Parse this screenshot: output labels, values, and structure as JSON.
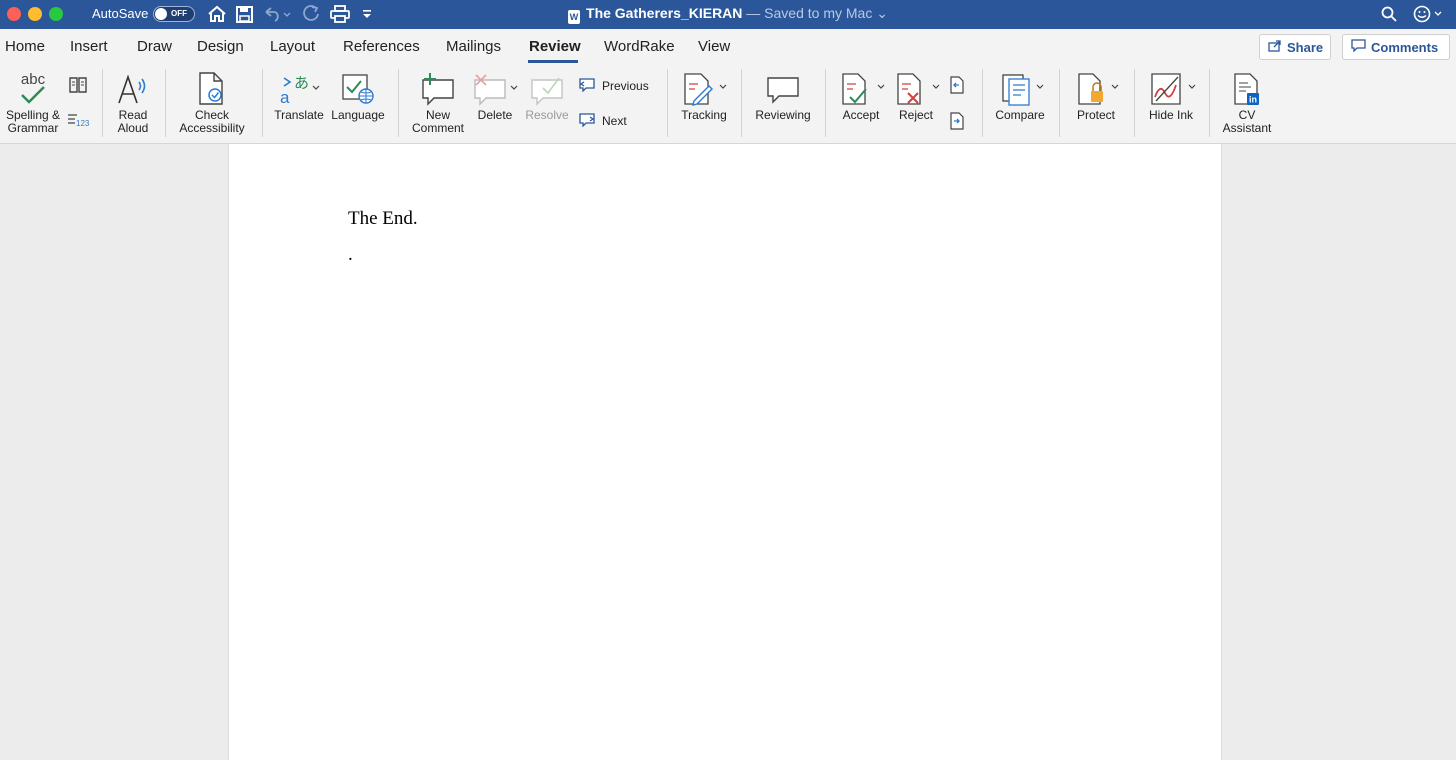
{
  "titlebar": {
    "autosave_label": "AutoSave",
    "autosave_state": "OFF",
    "doc_badge": "W",
    "doc_title": "The Gatherers_KIERAN",
    "saved_status": " — Saved to my Mac",
    "background": "#2b579a"
  },
  "tabs": [
    {
      "label": "Home"
    },
    {
      "label": "Insert"
    },
    {
      "label": "Draw"
    },
    {
      "label": "Design"
    },
    {
      "label": "Layout"
    },
    {
      "label": "References"
    },
    {
      "label": "Mailings"
    },
    {
      "label": "Review"
    },
    {
      "label": "WordRake"
    },
    {
      "label": "View"
    }
  ],
  "active_tab": "Review",
  "share_label": "Share",
  "comments_label": "Comments",
  "ribbon": {
    "spelling": "Spelling &\nGrammar",
    "read_aloud": "Read\nAloud",
    "check_accessibility": "Check\nAccessibility",
    "translate": "Translate",
    "language": "Language",
    "new_comment": "New\nComment",
    "delete": "Delete",
    "resolve": "Resolve",
    "previous": "Previous",
    "next": "Next",
    "tracking": "Tracking",
    "reviewing": "Reviewing",
    "accept": "Accept",
    "reject": "Reject",
    "compare": "Compare",
    "protect": "Protect",
    "hide_ink": "Hide Ink",
    "cv_assistant": "CV\nAssistant",
    "spelling_icon_text": "abc",
    "word_count_icon_text": "123"
  },
  "document": {
    "paragraphs": [
      "The End.",
      "."
    ]
  },
  "colors": {
    "accent": "#2b579a",
    "ribbon_bg": "#f3f3f3",
    "canvas_bg": "#ececec"
  }
}
